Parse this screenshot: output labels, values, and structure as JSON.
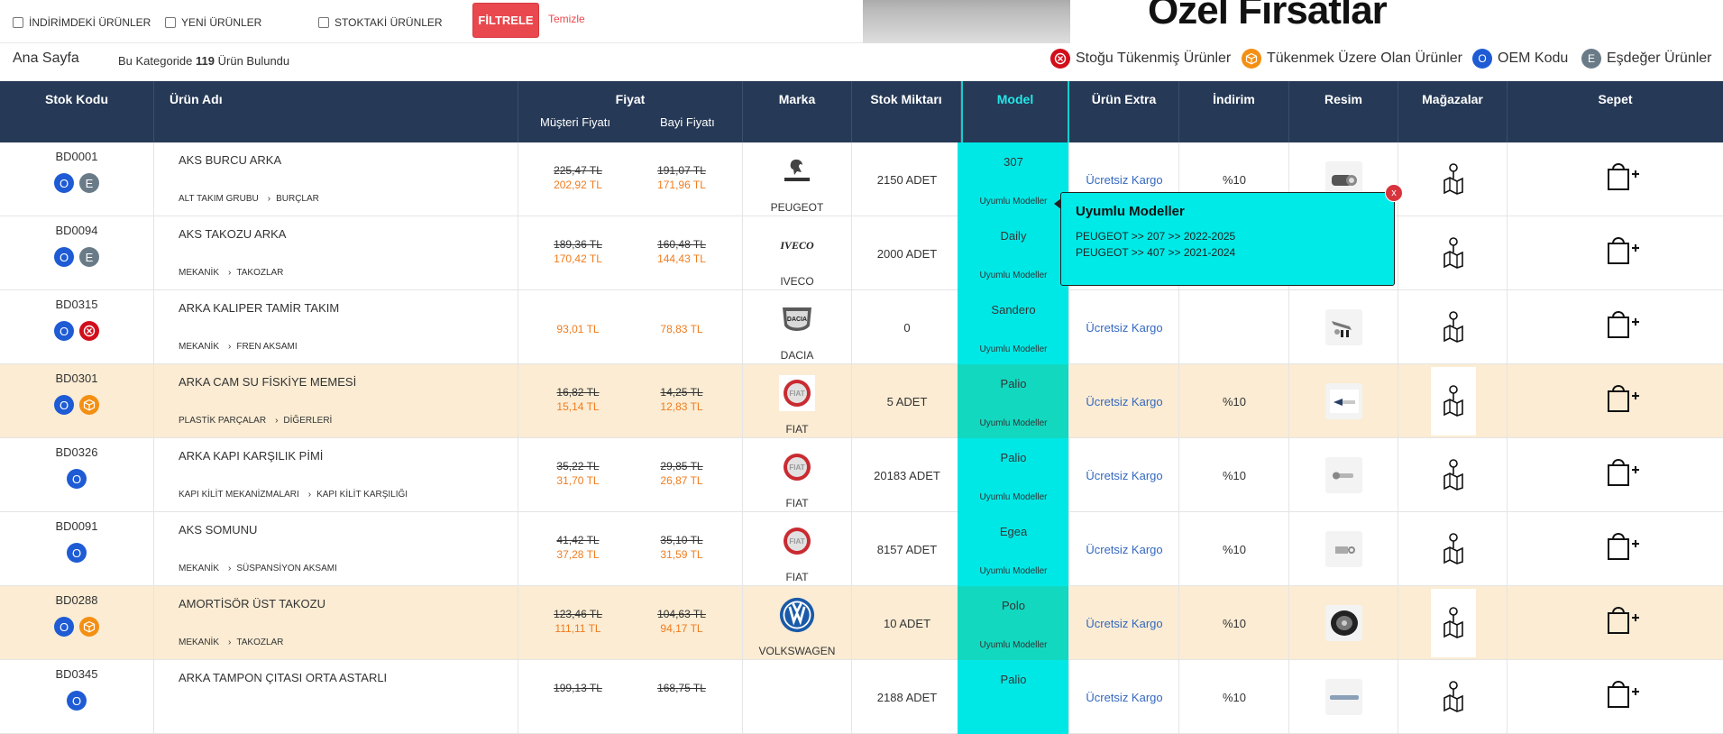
{
  "filters": {
    "discounted_label": "İNDİRİMDEKİ ÜRÜNLER",
    "new_label": "YENİ ÜRÜNLER",
    "in_stock_label": "STOKTAKİ ÜRÜNLER",
    "filter_button": "FİLTRELE",
    "clear_link": "Temizle"
  },
  "banner": {
    "text": "Özel Fırsatlar"
  },
  "breadcrumb": {
    "home": "Ana Sayfa",
    "count_prefix": "Bu Kategoride",
    "count": "119",
    "count_suffix": "Ürün Bulundu"
  },
  "legend": {
    "out_of_stock": "Stoğu Tükenmiş Ürünler",
    "low_stock": "Tükenmek Üzere Olan Ürünler",
    "oem": "OEM Kodu",
    "equivalent": "Eşdeğer Ürünler",
    "oem_letter": "O",
    "eq_letter": "E"
  },
  "columns": {
    "stock_code": "Stok Kodu",
    "product_name": "Ürün Adı",
    "price": "Fiyat",
    "customer_price": "Müşteri Fiyatı",
    "dealer_price": "Bayi Fiyatı",
    "brand": "Marka",
    "stock_qty": "Stok Miktarı",
    "model": "Model",
    "extra": "Ürün Extra",
    "discount": "İndirim",
    "image": "Resim",
    "stores": "Mağazalar",
    "cart": "Sepet"
  },
  "rows": [
    {
      "code": "BD0001",
      "badges": [
        "O",
        "E"
      ],
      "name": "AKS BURCU ARKA",
      "cat1": "ALT TAKIM GRUBU",
      "cat2": "BURÇLAR",
      "cust_old": "225,47 TL",
      "cust_new": "202,92 TL",
      "deal_old": "191,07 TL",
      "deal_new": "171,96 TL",
      "brand": "PEUGEOT",
      "stock": "2150 ADET",
      "model": "307",
      "model_link": "Uyumlu Modeller",
      "extra": "Ücretsiz Kargo",
      "discount": "%10"
    },
    {
      "code": "BD0094",
      "badges": [
        "O",
        "E"
      ],
      "name": "AKS TAKOZU ARKA",
      "cat1": "MEKANİK",
      "cat2": "TAKOZLAR",
      "cust_old": "189,36 TL",
      "cust_new": "170,42 TL",
      "deal_old": "160,48 TL",
      "deal_new": "144,43 TL",
      "brand": "IVECO",
      "stock": "2000 ADET",
      "model": "Daily",
      "model_link": "Uyumlu Modeller",
      "extra": "",
      "discount": ""
    },
    {
      "code": "BD0315",
      "badges": [
        "O",
        "X"
      ],
      "name": "ARKA KALIPER TAMİR TAKIM",
      "cat1": "MEKANİK",
      "cat2": "FREN AKSAMI",
      "cust_old": "",
      "cust_new": "93,01 TL",
      "deal_old": "",
      "deal_new": "78,83 TL",
      "brand": "DACIA",
      "stock": "0",
      "model": "Sandero",
      "model_link": "Uyumlu Modeller",
      "extra": "Ücretsiz Kargo",
      "discount": ""
    },
    {
      "code": "BD0301",
      "badges": [
        "O",
        "B"
      ],
      "name": "ARKA CAM SU FİSKİYE MEMESİ",
      "cat1": "PLASTİK PARÇALAR",
      "cat2": "DİĞERLERİ",
      "cust_old": "16,82 TL",
      "cust_new": "15,14 TL",
      "deal_old": "14,25 TL",
      "deal_new": "12,83 TL",
      "brand": "FIAT",
      "stock": "5 ADET",
      "model": "Palio",
      "model_link": "Uyumlu Modeller",
      "extra": "Ücretsiz Kargo",
      "discount": "%10"
    },
    {
      "code": "BD0326",
      "badges": [
        "O"
      ],
      "name": "ARKA KAPI KARŞILIK PİMİ",
      "cat1": "KAPI KİLİT MEKANİZMALARI",
      "cat2": "KAPI KİLİT KARŞILIĞI",
      "cust_old": "35,22 TL",
      "cust_new": "31,70 TL",
      "deal_old": "29,85 TL",
      "deal_new": "26,87 TL",
      "brand": "FIAT",
      "stock": "20183 ADET",
      "model": "Palio",
      "model_link": "Uyumlu Modeller",
      "extra": "Ücretsiz Kargo",
      "discount": "%10"
    },
    {
      "code": "BD0091",
      "badges": [
        "O"
      ],
      "name": "AKS SOMUNU",
      "cat1": "MEKANİK",
      "cat2": "SÜSPANSİYON AKSAMI",
      "cust_old": "41,42 TL",
      "cust_new": "37,28 TL",
      "deal_old": "35,10 TL",
      "deal_new": "31,59 TL",
      "brand": "FIAT",
      "stock": "8157 ADET",
      "model": "Egea",
      "model_link": "Uyumlu Modeller",
      "extra": "Ücretsiz Kargo",
      "discount": "%10"
    },
    {
      "code": "BD0288",
      "badges": [
        "O",
        "B"
      ],
      "name": "AMORTİSÖR ÜST TAKOZU",
      "cat1": "MEKANİK",
      "cat2": "TAKOZLAR",
      "cust_old": "123,46 TL",
      "cust_new": "111,11 TL",
      "deal_old": "104,63 TL",
      "deal_new": "94,17 TL",
      "brand": "VOLKSWAGEN",
      "stock": "10 ADET",
      "model": "Polo",
      "model_link": "Uyumlu Modeller",
      "extra": "Ücretsiz Kargo",
      "discount": "%10"
    },
    {
      "code": "BD0345",
      "badges": [
        "O"
      ],
      "name": "ARKA TAMPON ÇITASI ORTA ASTARLI",
      "cat1": "",
      "cat2": "",
      "cust_old": "199,13 TL",
      "cust_new": "",
      "deal_old": "168,75 TL",
      "deal_new": "",
      "brand": "",
      "stock": "2188 ADET",
      "model": "Palio",
      "model_link": "",
      "extra": "Ücretsiz Kargo",
      "discount": "%10"
    }
  ],
  "tooltip": {
    "title": "Uyumlu Modeller",
    "line1": "PEUGEOT >> 207 >> 2022-2025",
    "line2": "PEUGEOT >> 407 >> 2021-2024",
    "close": "x"
  },
  "colors": {
    "header_bg": "#263956",
    "model_col": "#00e8e6",
    "alt_row": "#fbecd3",
    "price_orange": "#f07c1e",
    "link_blue": "#3468c0",
    "filter_red": "#e9484e"
  }
}
